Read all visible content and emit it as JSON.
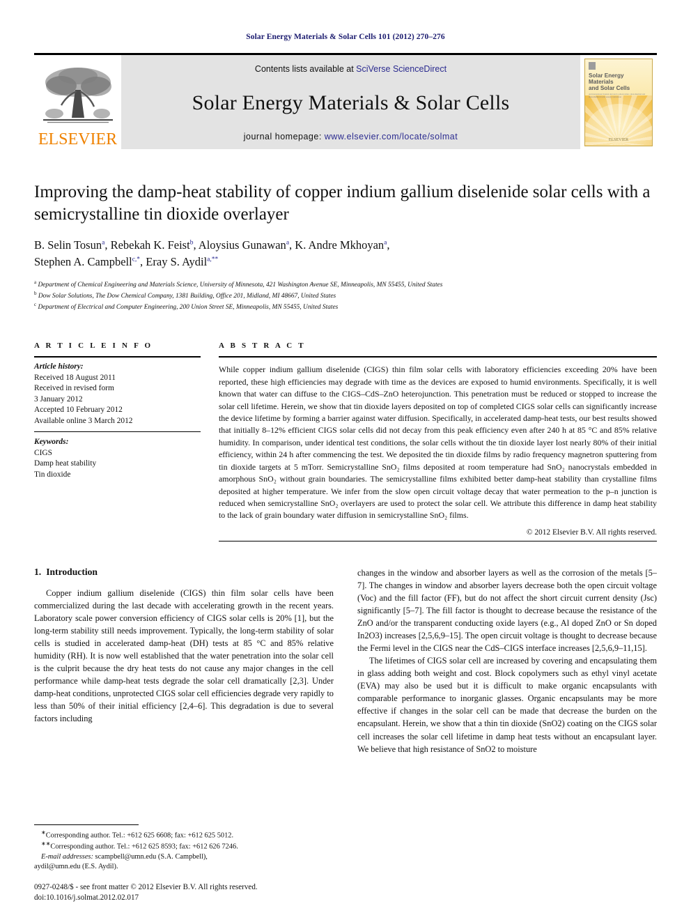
{
  "running_head": "Solar Energy Materials & Solar Cells 101 (2012) 270–276",
  "masthead": {
    "publisher_wordmark": "ELSEVIER",
    "contents_prefix": "Contents lists available at ",
    "contents_link": "SciVerse ScienceDirect",
    "journal_title": "Solar Energy Materials & Solar Cells",
    "homepage_prefix": "journal homepage: ",
    "homepage_url": "www.elsevier.com/locate/solmat",
    "cover": {
      "title_line1": "Solar Energy Materials",
      "title_line2": "and Solar Cells",
      "subtitle": "An International Journal devoted to photovoltaic, photothermal and photochemical solar energy conversion",
      "footer": "ELSEVIER"
    },
    "colors": {
      "elsevier_orange": "#ef8200",
      "link_blue": "#2b2b8f",
      "band_gray": "#e3e3e3"
    }
  },
  "article": {
    "title": "Improving the damp-heat stability of copper indium gallium diselenide solar cells with a semicrystalline tin dioxide overlayer",
    "authors_line1_parts": [
      {
        "name": "B. Selin Tosun",
        "sup": "a",
        "sep": ", "
      },
      {
        "name": "Rebekah K. Feist",
        "sup": "b",
        "sep": ", "
      },
      {
        "name": "Aloysius Gunawan",
        "sup": "a",
        "sep": ", "
      },
      {
        "name": "K. Andre Mkhoyan",
        "sup": "a",
        "sep": ","
      }
    ],
    "authors_line2_parts": [
      {
        "name": "Stephen A. Campbell",
        "sup": "c,*",
        "sep": ", "
      },
      {
        "name": "Eray S. Aydil",
        "sup": "a,**",
        "sep": ""
      }
    ],
    "affiliations": [
      {
        "mark": "a",
        "text": "Department of Chemical Engineering and Materials Science, University of Minnesota, 421 Washington Avenue SE, Minneapolis, MN 55455, United States"
      },
      {
        "mark": "b",
        "text": "Dow Solar Solutions, The Dow Chemical Company, 1381 Building, Office 201, Midland, MI 48667, United States"
      },
      {
        "mark": "c",
        "text": "Department of Electrical and Computer Engineering, 200 Union Street SE, Minneapolis, MN 55455, United States"
      }
    ]
  },
  "article_info": {
    "heading": "A R T I C L E   I N F O",
    "history_label": "Article history:",
    "history": [
      "Received 18 August 2011",
      "Received in revised form",
      "3 January 2012",
      "Accepted 10 February 2012",
      "Available online 3 March 2012"
    ],
    "keywords_label": "Keywords:",
    "keywords": [
      "CIGS",
      "Damp heat stability",
      "Tin dioxide"
    ]
  },
  "abstract": {
    "heading": "A B S T R A C T",
    "text": "While copper indium gallium diselenide (CIGS) thin film solar cells with laboratory efficiencies exceeding 20% have been reported, these high efficiencies may degrade with time as the devices are exposed to humid environments. Specifically, it is well known that water can diffuse to the CIGS–CdS–ZnO heterojunction. This penetration must be reduced or stopped to increase the solar cell lifetime. Herein, we show that tin dioxide layers deposited on top of completed CIGS solar cells can significantly increase the device lifetime by forming a barrier against water diffusion. Specifically, in accelerated damp-heat tests, our best results showed that initially 8–12% efficient CIGS solar cells did not decay from this peak efficiency even after 240 h at 85 °C and 85% relative humidity. In comparison, under identical test conditions, the solar cells without the tin dioxide layer lost nearly 80% of their initial efficiency, within 24 h after commencing the test. We deposited the tin dioxide films by radio frequency magnetron sputtering from tin dioxide targets at 5 mTorr. Semicrystalline SnO₂ films deposited at room temperature had SnO₂ nanocrystals embedded in amorphous SnO₂ without grain boundaries. The semicrystalline films exhibited better damp-heat stability than crystalline films deposited at higher temperature. We infer from the slow open circuit voltage decay that water permeation to the p–n junction is reduced when semicrystalline SnO₂ overlayers are used to protect the solar cell. We attribute this difference in damp heat stability to the lack of grain boundary water diffusion in semicrystalline SnO₂ films.",
    "copyright": "© 2012 Elsevier B.V. All rights reserved."
  },
  "section": {
    "number": "1.",
    "title": "Introduction"
  },
  "body": {
    "left_paragraphs": [
      "Copper indium gallium diselenide (CIGS) thin film solar cells have been commercialized during the last decade with accelerating growth in the recent years. Laboratory scale power conversion efficiency of CIGS solar cells is 20% [1], but the long-term stability still needs improvement. Typically, the long-term stability of solar cells is studied in accelerated damp-heat (DH) tests at 85 °C and 85% relative humidity (RH). It is now well established that the water penetration into the solar cell is the culprit because the dry heat tests do not cause any major changes in the cell performance while damp-heat tests degrade the solar cell dramatically [2,3]. Under damp-heat conditions, unprotected CIGS solar cell efficiencies degrade very rapidly to less than 50% of their initial efficiency [2,4–6]. This degradation is due to several factors including"
    ],
    "right_paragraphs": [
      "changes in the window and absorber layers as well as the corrosion of the metals [5–7]. The changes in window and absorber layers decrease both the open circuit voltage (Voc) and the fill factor (FF), but do not affect the short circuit current density (Jsc) significantly [5–7]. The fill factor is thought to decrease because the resistance of the ZnO and/or the transparent conducting oxide layers (e.g., Al doped ZnO or Sn doped In2O3) increases [2,5,6,9–15]. The open circuit voltage is thought to decrease because the Fermi level in the CIGS near the CdS–CIGS interface increases [2,5,6,9–11,15].",
      "The lifetimes of CIGS solar cell are increased by covering and encapsulating them in glass adding both weight and cost. Block copolymers such as ethyl vinyl acetate (EVA) may also be used but it is difficult to make organic encapsulants with comparable performance to inorganic glasses. Organic encapsulants may be more effective if changes in the solar cell can be made that decrease the burden on the encapsulant. Herein, we show that a thin tin dioxide (SnO2) coating on the CIGS solar cell increases the solar cell lifetime in damp heat tests without an encapsulant layer. We believe that high resistance of SnO2 to moisture"
    ]
  },
  "footnotes": {
    "corresponding1": "Corresponding author. Tel.: +612 625 6608; fax: +612 625 5012.",
    "corresponding2": "Corresponding author. Tel.: +612 625 8593; fax: +612 626 7246.",
    "email_label": "E-mail addresses:",
    "email1": "scampbell@umn.edu (S.A. Campbell),",
    "email2": "aydil@umn.edu (E.S. Aydil).",
    "issn_line": "0927-0248/$ - see front matter © 2012 Elsevier B.V. All rights reserved.",
    "doi_line": "doi:10.1016/j.solmat.2012.02.017"
  }
}
